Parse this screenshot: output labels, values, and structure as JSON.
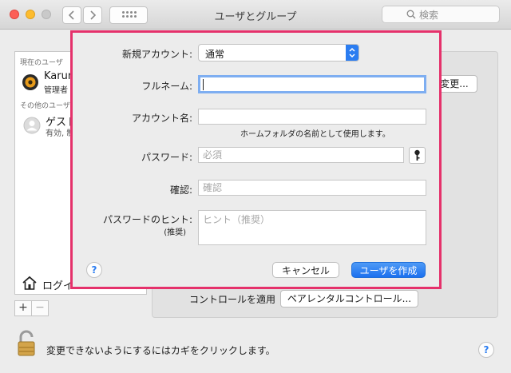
{
  "window": {
    "title": "ユーザとグループ",
    "search_placeholder": "検索"
  },
  "sidebar": {
    "current_users_label": "現在のユーザ",
    "current_user_name": "Karum",
    "current_user_role": "管理者",
    "other_users_label": "その他のユーザ",
    "guest_name": "ゲスト",
    "guest_status": "有効, 制",
    "login_options": "ログイ",
    "add_label": "+",
    "remove_label": "−"
  },
  "main": {
    "change_button": "変更...",
    "apply_controls_label": "コントロールを適用",
    "parental_controls_button": "ペアレンタルコントロール..."
  },
  "footer": {
    "lock_text": "変更できないようにするにはカギをクリックします。",
    "help": "?"
  },
  "dialog": {
    "new_account_label": "新規アカウント:",
    "new_account_value": "通常",
    "full_name_label": "フルネーム:",
    "full_name_value": "",
    "account_name_label": "アカウント名:",
    "account_name_value": "",
    "account_name_hint": "ホームフォルダの名前として使用します。",
    "password_label": "パスワード:",
    "password_placeholder": "必須",
    "verify_label": "確認:",
    "verify_placeholder": "確認",
    "hint_label": "パスワードのヒント:",
    "hint_label_sub": "(推奨)",
    "hint_placeholder": "ヒント（推奨）",
    "help": "?",
    "cancel_button": "キャンセル",
    "create_button": "ユーザを作成"
  }
}
